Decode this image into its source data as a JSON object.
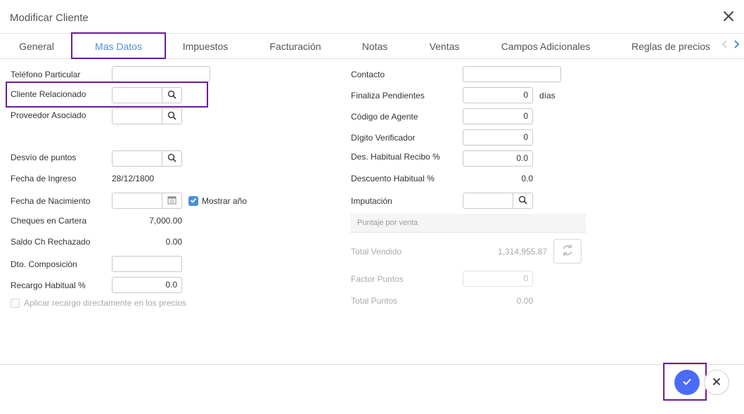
{
  "dialog": {
    "title": "Modificar Cliente"
  },
  "tabs": [
    {
      "label": "General"
    },
    {
      "label": "Mas Datos"
    },
    {
      "label": "Impuestos"
    },
    {
      "label": "Facturación"
    },
    {
      "label": "Notas"
    },
    {
      "label": "Ventas"
    },
    {
      "label": "Campos Adicionales"
    },
    {
      "label": "Reglas de precios"
    }
  ],
  "colors": {
    "accent": "#4a90d9",
    "highlight": "#6a1b9a",
    "primary_button": "#4a6cf7"
  },
  "left": {
    "telefono_particular": {
      "label": "Teléfono Particular",
      "value": ""
    },
    "cliente_relacionado": {
      "label": "Cliente Relacionado",
      "value": ""
    },
    "proveedor_asociado": {
      "label": "Proveedor Asociado",
      "value": ""
    },
    "desvio_puntos": {
      "label": "Desvío de puntos",
      "value": ""
    },
    "fecha_ingreso": {
      "label": "Fecha de Ingreso",
      "value": "28/12/1800"
    },
    "fecha_nacimiento": {
      "label": "Fecha de Nacimiento",
      "value": "",
      "show_year_label": "Mostrar año",
      "show_year_checked": true
    },
    "cheques_cartera": {
      "label": "Cheques en Cartera",
      "value": "7,000.00"
    },
    "saldo_ch_rechazado": {
      "label": "Saldo Ch Rechazado",
      "value": "0.00"
    },
    "dto_composicion": {
      "label": "Dto. Composición",
      "value": ""
    },
    "recargo_habitual": {
      "label": "Recargo Habitual %",
      "value": "0.0"
    },
    "aplicar_recargo": {
      "label": "Aplicar recargo directamente en los precios",
      "checked": false
    }
  },
  "right": {
    "contacto": {
      "label": "Contacto",
      "value": ""
    },
    "finaliza_pendientes": {
      "label": "Finaliza Pendientes",
      "value": "0",
      "unit": "días"
    },
    "codigo_agente": {
      "label": "Código de Agente",
      "value": "0"
    },
    "digito_verificador": {
      "label": "Dígito Verificador",
      "value": "0"
    },
    "des_habitual_recibo": {
      "label": "Des. Habitual Recibo %",
      "value": "0.0"
    },
    "descuento_habitual": {
      "label": "Descuento Habitual %",
      "value": "0.0"
    },
    "imputacion": {
      "label": "Imputación",
      "value": ""
    },
    "puntaje_section": {
      "label": "Puntaje por venta"
    },
    "total_vendido": {
      "label": "Total Vendido",
      "value": "1,314,955.87"
    },
    "factor_puntos": {
      "label": "Factor Puntos",
      "value": "0"
    },
    "total_puntos": {
      "label": "Total Puntos",
      "value": "0.00"
    }
  },
  "icons": {
    "close": "close-icon",
    "search": "search-icon",
    "calendar": "calendar-icon",
    "refresh": "refresh-icon",
    "check": "check-icon",
    "chevron_left": "chevron-left-icon",
    "chevron_right": "chevron-right-icon"
  }
}
